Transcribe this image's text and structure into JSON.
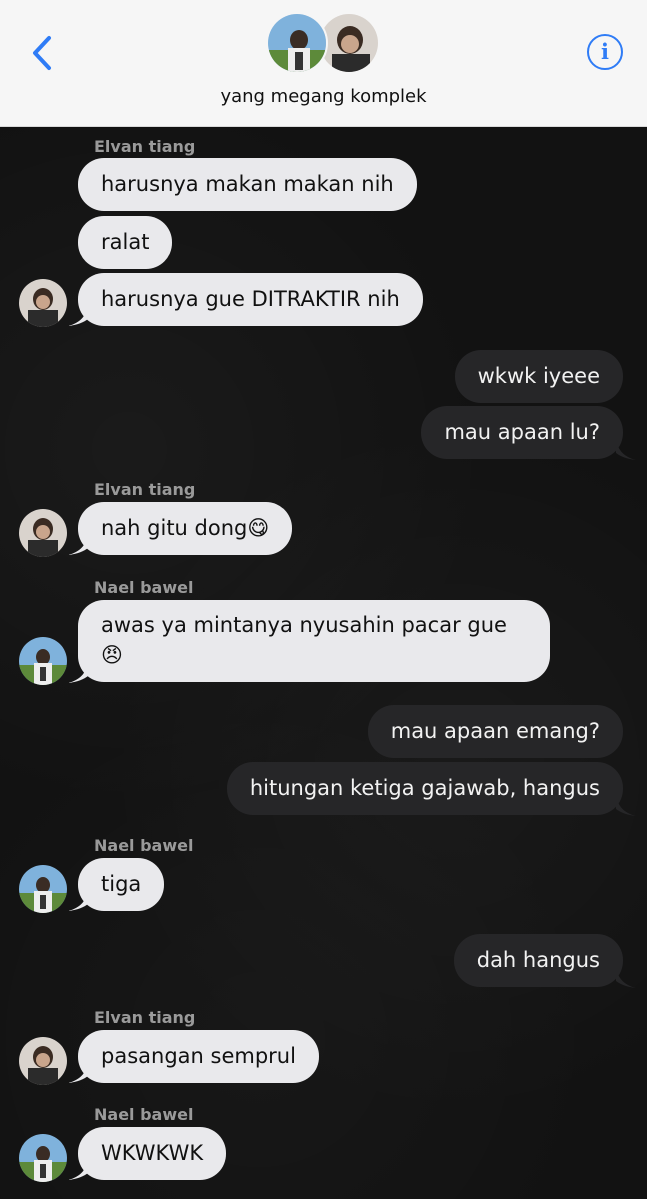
{
  "header": {
    "group_name": "yang megang komplek"
  },
  "colors": {
    "accent": "#2f7cf6",
    "incoming_bubble": "#e9e9ec",
    "outgoing_bubble": "#262628",
    "chat_background": "#121212"
  },
  "messages": {
    "s1": "Elvan tiang",
    "m1": "harusnya makan makan nih",
    "m2": "ralat",
    "m3": "harusnya gue DITRAKTIR nih",
    "m4": "wkwk iyeee",
    "m5": "mau apaan lu?",
    "s2": "Elvan tiang",
    "m6": "nah gitu dong😋",
    "s3": "Nael bawel",
    "m7": "awas ya mintanya nyusahin pacar gue 😠",
    "m8": "mau apaan emang?",
    "m9": "hitungan ketiga gajawab, hangus",
    "s4": "Nael bawel",
    "m10": "tiga",
    "m11": "dah hangus",
    "s5": "Elvan tiang",
    "m12": "pasangan semprul",
    "s6": "Nael bawel",
    "m13": "WKWKWK"
  },
  "icons": {
    "back": "chevron-left-icon",
    "info": "info-icon"
  }
}
